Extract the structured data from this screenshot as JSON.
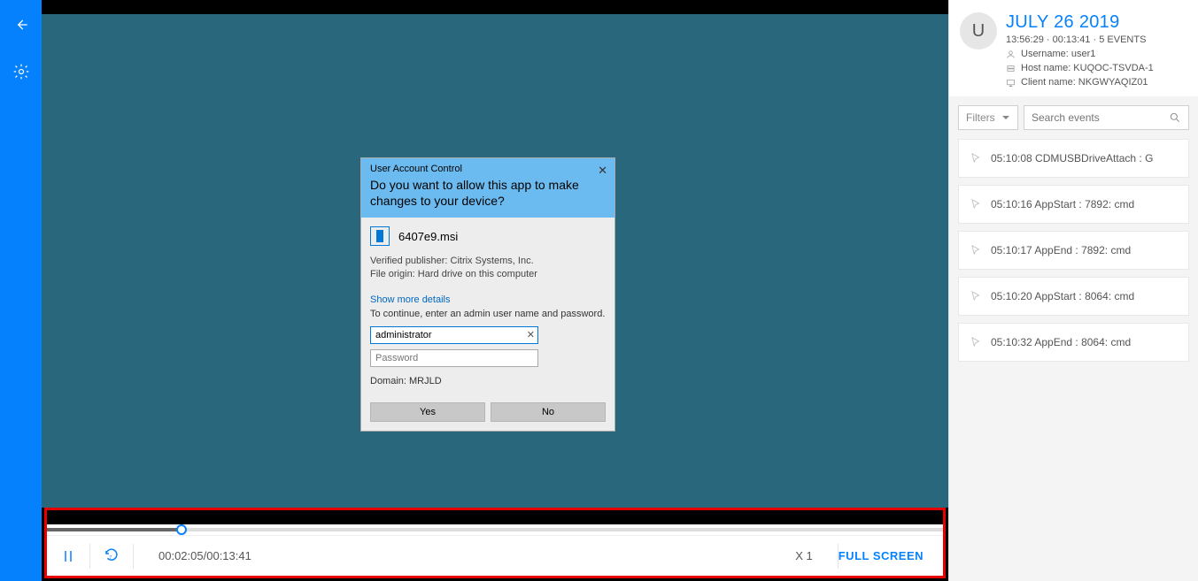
{
  "session": {
    "date": "JULY 26 2019",
    "start_time": "13:56:29",
    "duration": "00:13:41",
    "event_count_label": "5 EVENTS",
    "username_label": "Username: user1",
    "hostname_label": "Host name: KUQOC-TSVDA-1",
    "clientname_label": "Client name: NKGWYAQIZ01",
    "avatar_initial": "U"
  },
  "filters": {
    "label": "Filters"
  },
  "search": {
    "placeholder": "Search events"
  },
  "events": [
    {
      "text": "05:10:08 CDMUSBDriveAttach : G"
    },
    {
      "text": "05:10:16 AppStart : 7892: cmd"
    },
    {
      "text": "05:10:17 AppEnd : 7892: cmd"
    },
    {
      "text": "05:10:20 AppStart : 8064: cmd"
    },
    {
      "text": "05:10:32 AppEnd : 8064: cmd"
    }
  ],
  "player": {
    "current": "00:02:05",
    "total": "00:13:41",
    "speed": "X 1",
    "fullscreen_label": "FULL SCREEN",
    "progress_pct": 15
  },
  "uac": {
    "title": "User Account Control",
    "question": "Do you want to allow this app to make changes to your device?",
    "filename": "6407e9.msi",
    "publisher": "Verified publisher: Citrix Systems, Inc.",
    "origin": "File origin: Hard drive on this computer",
    "more_details": "Show more details",
    "continue_text": "To continue, enter an admin user name and password.",
    "username_value": "administrator",
    "password_placeholder": "Password",
    "domain": "Domain: MRJLD",
    "yes": "Yes",
    "no": "No"
  }
}
